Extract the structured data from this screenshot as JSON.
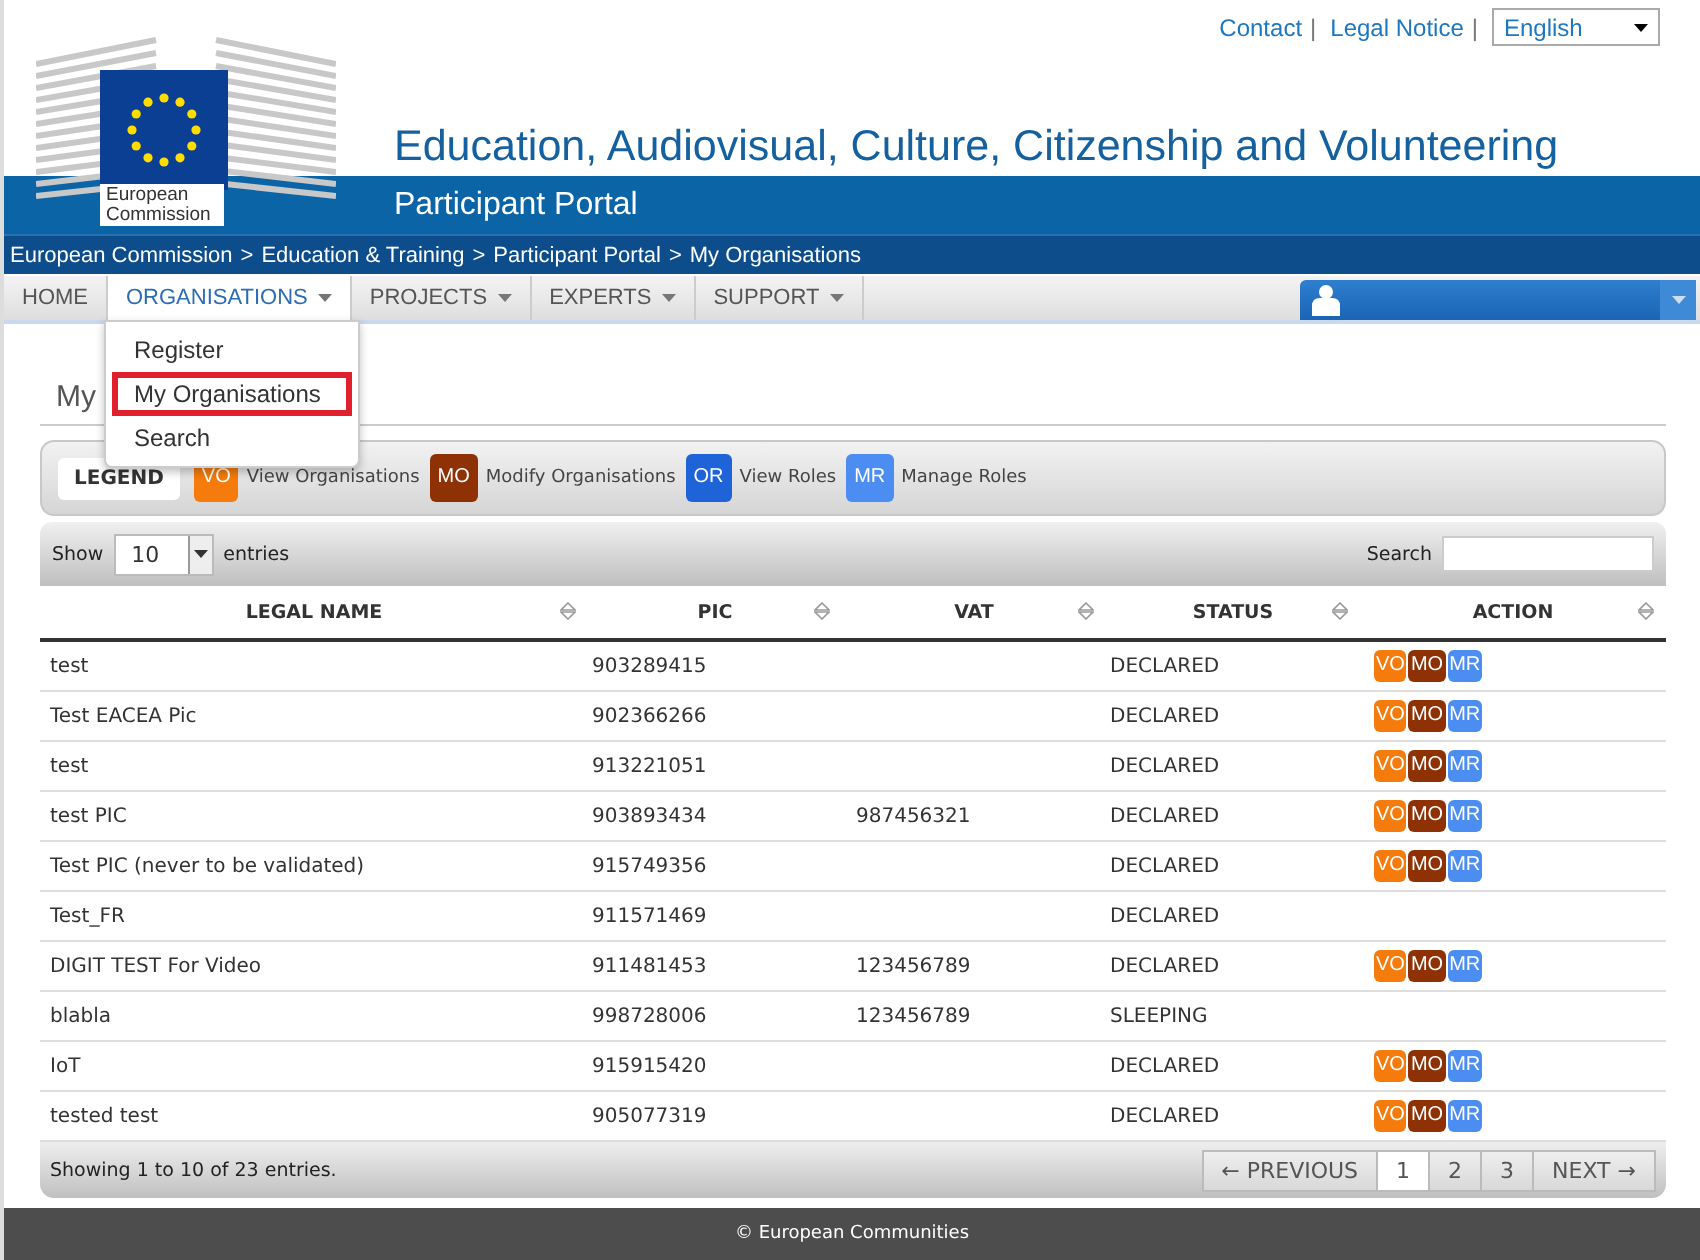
{
  "top_links": [
    {
      "label": "Contact"
    },
    {
      "label": "Legal Notice"
    }
  ],
  "link_separator": "|",
  "breadcrumb_separator": ">",
  "language": {
    "value": "English"
  },
  "logo": {
    "text": "European Commission"
  },
  "header": {
    "title": "Education, Audiovisual, Culture, Citizenship and Volunteering",
    "subtitle": "Participant Portal"
  },
  "breadcrumb": [
    "European Commission",
    "Education & Training",
    "Participant Portal",
    "My Organisations"
  ],
  "nav": [
    {
      "label": "HOME",
      "dropdown": false,
      "selected": false
    },
    {
      "label": "ORGANISATIONS",
      "dropdown": true,
      "selected": true
    },
    {
      "label": "PROJECTS",
      "dropdown": true,
      "selected": false
    },
    {
      "label": "EXPERTS",
      "dropdown": true,
      "selected": false
    },
    {
      "label": "SUPPORT",
      "dropdown": true,
      "selected": false
    }
  ],
  "menu": [
    {
      "label": "Register",
      "selected": false
    },
    {
      "label": "My Organisations",
      "selected": true
    },
    {
      "label": "Search",
      "selected": false
    }
  ],
  "page_title": "My",
  "legend": {
    "label": "LEGEND",
    "items": [
      {
        "code": "VO",
        "label": "View Organisations",
        "color": "#f47b0c"
      },
      {
        "code": "MO",
        "label": "Modify Organisations",
        "color": "#8e3206"
      },
      {
        "code": "OR",
        "label": "View Roles",
        "color": "#1e64d8"
      },
      {
        "code": "MR",
        "label": "Manage Roles",
        "color": "#4c8df2"
      }
    ]
  },
  "table": {
    "show_label": "Show",
    "page_size": "10",
    "entries_label": "entries",
    "search_label": "Search",
    "columns": [
      "LEGAL NAME",
      "PIC",
      "VAT",
      "STATUS",
      "ACTION"
    ],
    "rows": [
      {
        "name": "test",
        "pic": "903289415",
        "vat": "",
        "status": "DECLARED",
        "actions": [
          {
            "code": "VO",
            "color": "#f47b0c"
          },
          {
            "code": "MO",
            "color": "#8e3206"
          },
          {
            "code": "MR",
            "color": "#4c8df2"
          }
        ]
      },
      {
        "name": "Test EACEA Pic",
        "pic": "902366266",
        "vat": "",
        "status": "DECLARED",
        "actions": [
          {
            "code": "VO",
            "color": "#f47b0c"
          },
          {
            "code": "MO",
            "color": "#8e3206"
          },
          {
            "code": "MR",
            "color": "#4c8df2"
          }
        ]
      },
      {
        "name": "test",
        "pic": "913221051",
        "vat": "",
        "status": "DECLARED",
        "actions": [
          {
            "code": "VO",
            "color": "#f47b0c"
          },
          {
            "code": "MO",
            "color": "#8e3206"
          },
          {
            "code": "MR",
            "color": "#4c8df2"
          }
        ]
      },
      {
        "name": "test PIC",
        "pic": "903893434",
        "vat": "987456321",
        "status": "DECLARED",
        "actions": [
          {
            "code": "VO",
            "color": "#f47b0c"
          },
          {
            "code": "MO",
            "color": "#8e3206"
          },
          {
            "code": "MR",
            "color": "#4c8df2"
          }
        ]
      },
      {
        "name": "Test PIC (never to be validated)",
        "pic": "915749356",
        "vat": "",
        "status": "DECLARED",
        "actions": [
          {
            "code": "VO",
            "color": "#f47b0c"
          },
          {
            "code": "MO",
            "color": "#8e3206"
          },
          {
            "code": "MR",
            "color": "#4c8df2"
          }
        ]
      },
      {
        "name": "Test_FR",
        "pic": "911571469",
        "vat": "",
        "status": "DECLARED",
        "actions": []
      },
      {
        "name": "DIGIT TEST For Video",
        "pic": "911481453",
        "vat": "123456789",
        "status": "DECLARED",
        "actions": [
          {
            "code": "VO",
            "color": "#f47b0c"
          },
          {
            "code": "MO",
            "color": "#8e3206"
          },
          {
            "code": "MR",
            "color": "#4c8df2"
          }
        ]
      },
      {
        "name": "blabla",
        "pic": "998728006",
        "vat": "123456789",
        "status": "SLEEPING",
        "actions": []
      },
      {
        "name": "IoT",
        "pic": "915915420",
        "vat": "",
        "status": "DECLARED",
        "actions": [
          {
            "code": "VO",
            "color": "#f47b0c"
          },
          {
            "code": "MO",
            "color": "#8e3206"
          },
          {
            "code": "MR",
            "color": "#4c8df2"
          }
        ]
      },
      {
        "name": "tested test",
        "pic": "905077319",
        "vat": "",
        "status": "DECLARED",
        "actions": [
          {
            "code": "VO",
            "color": "#f47b0c"
          },
          {
            "code": "MO",
            "color": "#8e3206"
          },
          {
            "code": "MR",
            "color": "#4c8df2"
          }
        ]
      }
    ],
    "info": "Showing 1 to 10 of 23 entries.",
    "pagination": [
      {
        "label": "← PREVIOUS",
        "selected": false
      },
      {
        "label": "1",
        "selected": true
      },
      {
        "label": "2",
        "selected": false
      },
      {
        "label": "3",
        "selected": false
      },
      {
        "label": "NEXT →",
        "selected": false
      }
    ]
  },
  "footer": "© European Communities"
}
